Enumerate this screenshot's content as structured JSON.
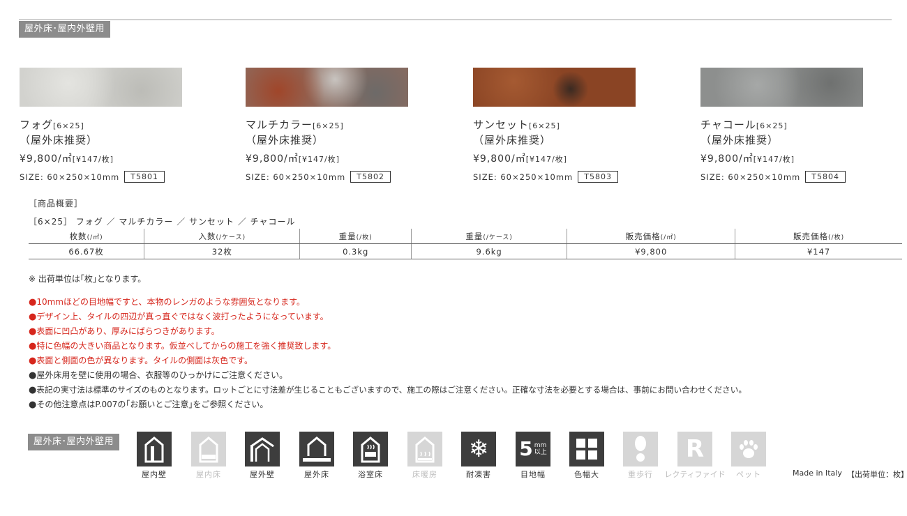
{
  "header": {
    "tag": "屋外床･屋内外壁用"
  },
  "products": [
    {
      "name": "フォグ",
      "dim": "[6×25]",
      "note": "（屋外床推奨）",
      "price": "¥9,800/㎡",
      "price_piece": "[¥147/枚]",
      "size": "SIZE: 60×250×10mm",
      "code": "T5801",
      "color": "#d2d2ce"
    },
    {
      "name": "マルチカラー",
      "dim": "[6×25]",
      "note": "（屋外床推奨）",
      "price": "¥9,800/㎡",
      "price_piece": "[¥147/枚]",
      "size": "SIZE: 60×250×10mm",
      "code": "T5802",
      "color": "#8e6b5e"
    },
    {
      "name": "サンセット",
      "dim": "[6×25]",
      "note": "（屋外床推奨）",
      "price": "¥9,800/㎡",
      "price_piece": "[¥147/枚]",
      "size": "SIZE: 60×250×10mm",
      "code": "T5803",
      "color": "#8a4424"
    },
    {
      "name": "チャコール",
      "dim": "[6×25]",
      "note": "（屋外床推奨）",
      "price": "¥9,800/㎡",
      "price_piece": "[¥147/枚]",
      "size": "SIZE: 60×250×10mm",
      "code": "T5804",
      "color": "#8d8f8e"
    }
  ],
  "overview": {
    "title": "［商品概要］",
    "subtitle": "［6×25］ フォグ ／ マルチカラー ／ サンセット ／ チャコール",
    "headers": [
      {
        "label": "枚数",
        "unit": "(/㎡)"
      },
      {
        "label": "入数",
        "unit": "(/ケース)"
      },
      {
        "label": "重量",
        "unit": "(/枚)"
      },
      {
        "label": "重量",
        "unit": "(/ケース)"
      },
      {
        "label": "販売価格",
        "unit": "(/㎡)"
      },
      {
        "label": "販売価格",
        "unit": "(/枚)"
      }
    ],
    "values": [
      "66.67枚",
      "32枚",
      "0.3kg",
      "9.6kg",
      "¥9,800",
      "¥147"
    ]
  },
  "shipping_note": "※ 出荷単位は｢枚｣となります。",
  "bullets": [
    {
      "text": "10mmほどの目地幅ですと、本物のレンガのような雰囲気となります。",
      "color": "red"
    },
    {
      "text": "デザイン上、タイルの四辺が真っ直ぐではなく波打ったようになっています。",
      "color": "red"
    },
    {
      "text": "表面に凹凸があり、厚みにばらつきがあります。",
      "color": "red"
    },
    {
      "text": "特に色幅の大きい商品となります。仮並べしてからの施工を強く推奨致します。",
      "color": "red"
    },
    {
      "text": "表面と側面の色が異なります。タイルの側面は灰色です。",
      "color": "red"
    },
    {
      "text": "屋外床用を壁に使用の場合、衣服等のひっかけにご注意ください。",
      "color": "black"
    },
    {
      "text": "表記の実寸法は標準のサイズのものとなります。ロットごとに寸法差が生じることもございますので、施工の際はご注意ください。正確な寸法を必要とする場合は、事前にお問い合わせください。",
      "color": "black"
    },
    {
      "text": "その他注意点はP.007の｢お願いとご注意｣をご参照ください。",
      "color": "black"
    }
  ],
  "bullet_mark": "●",
  "usage_tag": "屋外床･屋内外壁用",
  "icons": [
    {
      "label": "屋内壁",
      "active": true,
      "icon": "indoor-wall-icon"
    },
    {
      "label": "屋内床",
      "active": false,
      "icon": "indoor-floor-icon"
    },
    {
      "label": "屋外壁",
      "active": true,
      "icon": "outdoor-wall-icon"
    },
    {
      "label": "屋外床",
      "active": true,
      "icon": "outdoor-floor-icon"
    },
    {
      "label": "浴室床",
      "active": true,
      "icon": "bath-floor-icon"
    },
    {
      "label": "床暖房",
      "active": false,
      "icon": "floor-heating-icon"
    },
    {
      "label": "耐凍害",
      "active": true,
      "icon": "snowflake-icon",
      "glyph": "❄"
    },
    {
      "label": "目地幅",
      "active": true,
      "icon": "joint-width-icon",
      "num": "5",
      "unit_top": "mm",
      "unit_bottom": "以上"
    },
    {
      "label": "色幅大",
      "active": true,
      "icon": "color-variation-icon"
    },
    {
      "label": "重歩行",
      "active": false,
      "icon": "footprint-icon"
    },
    {
      "label": "レクティファイド",
      "active": false,
      "icon": "rectified-icon",
      "glyph": "R"
    },
    {
      "label": "ペット",
      "active": false,
      "icon": "pet-paw-icon"
    }
  ],
  "footer": {
    "origin": "Made in Italy",
    "unit": "【出荷単位：枚】"
  }
}
